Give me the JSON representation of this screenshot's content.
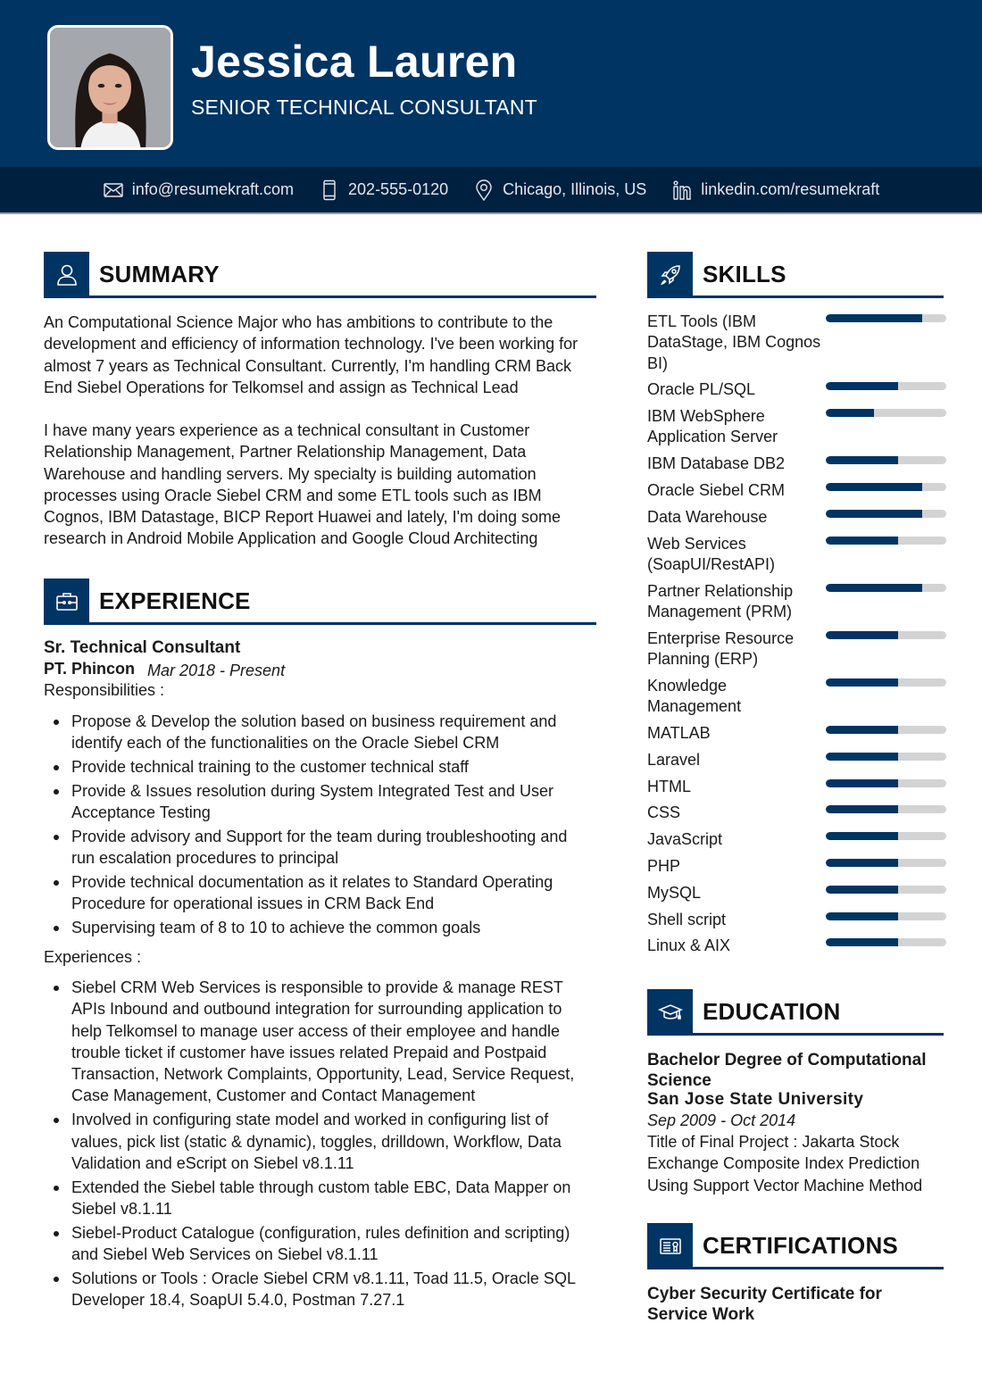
{
  "header": {
    "name": "Jessica Lauren",
    "title": "SENIOR TECHNICAL CONSULTANT",
    "photo_alt": "Portrait photo of Jessica Lauren"
  },
  "contact": {
    "email": {
      "icon": "envelope-icon",
      "text": "info@resumekraft.com"
    },
    "phone": {
      "icon": "phone-icon",
      "text": "202-555-0120"
    },
    "location": {
      "icon": "location-pin-icon",
      "text": "Chicago, Illinois, US"
    },
    "linkedin": {
      "icon": "linkedin-icon",
      "text": "linkedin.com/resumekraft"
    }
  },
  "colors": {
    "primary": "#003462",
    "contact_bar": "#00203f",
    "bar_track": "#d3d3d3"
  },
  "summary": {
    "heading": "SUMMARY",
    "icon": "user-icon",
    "paragraphs": [
      "An Computational Science Major who has ambitions to contribute to the development and efficiency of information technology. I've been working for almost 7 years as Technical Consultant. Currently, I'm handling CRM Back End Siebel Operations for Telkomsel and assign as Technical Lead",
      "I have many years experience as a technical consultant in Customer Relationship Management, Partner Relationship Management, Data Warehouse and handling servers. My specialty is building automation processes using Oracle Siebel CRM and some ETL tools such as IBM Cognos, IBM Datastage, BICP Report Huawei and lately, I'm doing some research in Android Mobile Application and Google Cloud Architecting"
    ]
  },
  "experience": {
    "heading": "EXPERIENCE",
    "icon": "briefcase-icon",
    "jobs": [
      {
        "role": "Sr. Technical Consultant",
        "company": "PT. Phincon",
        "dates": "Mar 2018 - Present",
        "responsibilities_label": "Responsibilities :",
        "responsibilities": [
          "Propose & Develop the solution based on business requirement and identify each of the functionalities on the Oracle Siebel CRM",
          "Provide technical training to the customer technical staff",
          "Provide & Issues resolution during System Integrated Test and User Acceptance Testing",
          "Provide advisory and Support for the team during troubleshooting and run escalation procedures to principal",
          "Provide technical documentation as it relates to Standard Operating Procedure for operational issues in CRM Back End",
          "Supervising team of 8 to 10 to achieve the common goals"
        ],
        "experiences_label": "Experiences :",
        "experiences": [
          "Siebel CRM Web Services is responsible to provide & manage REST APIs Inbound and outbound integration for surrounding application to help Telkomsel to manage user access of their employee and handle trouble ticket if customer have issues related Prepaid and Postpaid Transaction, Network Complaints, Opportunity, Lead, Service Request, Case Management, Customer and Contact Management",
          "Involved in configuring state model and worked in configuring list of values, pick list (static & dynamic), toggles, drilldown, Workflow, Data Validation and eScript on Siebel v8.1.11",
          "Extended the Siebel table through custom table EBC, Data Mapper on Siebel v8.1.11",
          "Siebel-Product Catalogue (configuration, rules definition and scripting) and Siebel Web Services on Siebel v8.1.11",
          "Solutions or Tools :  Oracle Siebel CRM v8.1.11, Toad 11.5, Oracle SQL Developer 18.4, SoapUI 5.4.0, Postman 7.27.1"
        ]
      }
    ]
  },
  "skills": {
    "heading": "SKILLS",
    "icon": "rocket-icon",
    "items": [
      {
        "name": "ETL Tools (IBM DataStage, IBM Cognos BI)",
        "level": 80
      },
      {
        "name": "Oracle PL/SQL",
        "level": 60
      },
      {
        "name": "IBM WebSphere Application Server",
        "level": 40
      },
      {
        "name": "IBM Database DB2",
        "level": 60
      },
      {
        "name": "Oracle Siebel CRM",
        "level": 80
      },
      {
        "name": "Data Warehouse",
        "level": 80
      },
      {
        "name": "Web Services (SoapUI/RestAPI)",
        "level": 60
      },
      {
        "name": "Partner Relationship Management (PRM)",
        "level": 80
      },
      {
        "name": "Enterprise Resource Planning (ERP)",
        "level": 60
      },
      {
        "name": "Knowledge Management",
        "level": 60
      },
      {
        "name": "MATLAB",
        "level": 60
      },
      {
        "name": "Laravel",
        "level": 60
      },
      {
        "name": "HTML",
        "level": 60
      },
      {
        "name": "CSS",
        "level": 60
      },
      {
        "name": "JavaScript",
        "level": 60
      },
      {
        "name": "PHP",
        "level": 60
      },
      {
        "name": "MySQL",
        "level": 60
      },
      {
        "name": "Shell script",
        "level": 60
      },
      {
        "name": "Linux & AIX",
        "level": 60
      }
    ]
  },
  "education": {
    "heading": "EDUCATION",
    "icon": "graduation-cap-icon",
    "degree": "Bachelor Degree of Computational Science",
    "school": "San Jose State University",
    "dates": "Sep 2009 - Oct 2014",
    "description": "Title of Final Project : Jakarta Stock Exchange Composite Index Prediction Using Support Vector Machine Method"
  },
  "certifications": {
    "heading": "CERTIFICATIONS",
    "icon": "certificate-icon",
    "items": [
      "Cyber Security Certificate for Service Work"
    ]
  }
}
